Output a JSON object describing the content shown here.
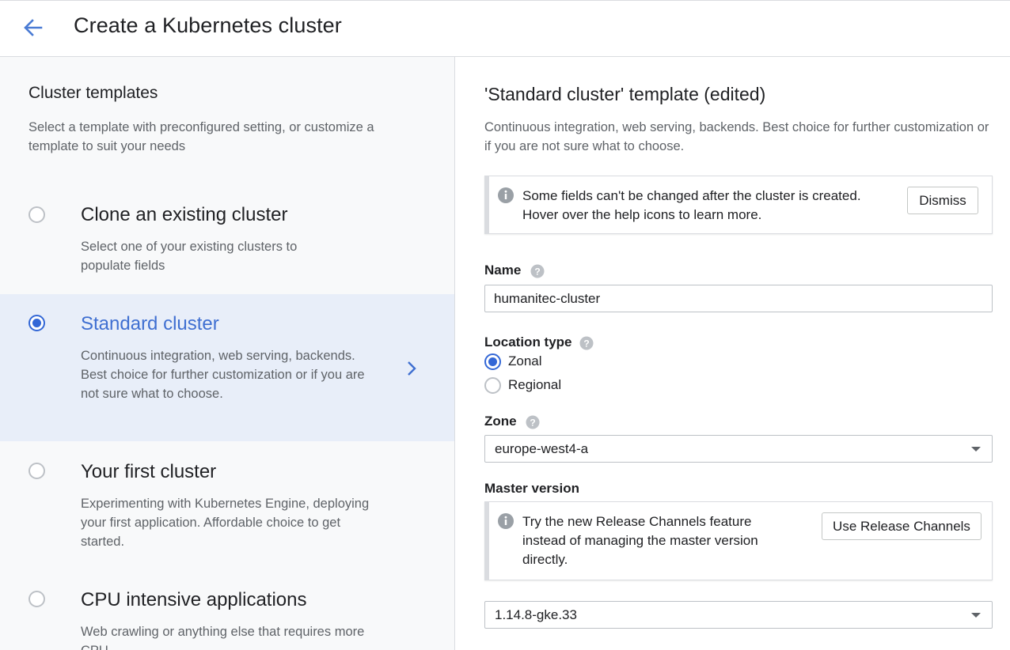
{
  "header": {
    "title": "Create a Kubernetes cluster",
    "back_icon": "arrow-back-icon"
  },
  "templates_panel": {
    "title": "Cluster templates",
    "description": "Select a template with preconfigured setting, or customize a template to suit your needs",
    "items": [
      {
        "name": "Clone an existing cluster",
        "description": "Select one of your existing clusters to populate fields",
        "selected": false
      },
      {
        "name": "Standard cluster",
        "description": "Continuous integration, web serving, backends. Best choice for further customization or if you are not sure what to choose.",
        "selected": true
      },
      {
        "name": "Your first cluster",
        "description": "Experimenting with Kubernetes Engine, deploying your first application. Affordable choice to get started.",
        "selected": false
      },
      {
        "name": "CPU intensive applications",
        "description": "Web crawling or anything else that requires more CPU",
        "selected": false
      }
    ]
  },
  "form": {
    "title": "'Standard cluster' template (edited)",
    "description": "Continuous integration, web serving, backends. Best choice for further customization or if you are not sure what to choose.",
    "notice": {
      "line1": "Some fields can't be changed after the cluster is created.",
      "line2": "Hover over the help icons to learn more.",
      "dismiss_label": "Dismiss"
    },
    "name": {
      "label": "Name",
      "value": "humanitec-cluster"
    },
    "location_type": {
      "label": "Location type",
      "options": [
        {
          "label": "Zonal",
          "selected": true
        },
        {
          "label": "Regional",
          "selected": false
        }
      ]
    },
    "zone": {
      "label": "Zone",
      "value": "europe-west4-a"
    },
    "master_version": {
      "label": "Master version",
      "notice_line1": "Try the new Release Channels feature",
      "notice_line2": "instead of managing the master version",
      "notice_line3": "directly.",
      "button_label": "Use Release Channels",
      "value": "1.14.8-gke.33"
    }
  },
  "colors": {
    "accent": "#3367d6",
    "selected_bg": "#e8eef9",
    "panel_bg": "#f8f9fa"
  }
}
